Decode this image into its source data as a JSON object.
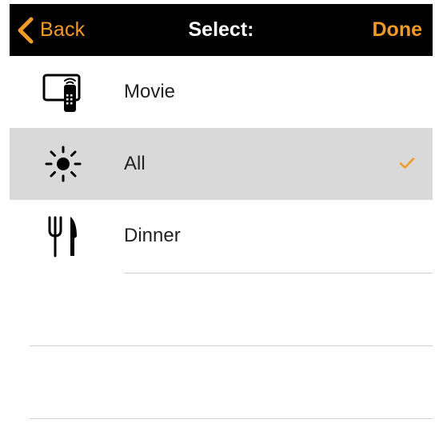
{
  "navbar": {
    "back_label": "Back",
    "title": "Select:",
    "done_label": "Done"
  },
  "options": [
    {
      "label": "Movie",
      "icon": "tv-remote-icon",
      "selected": false
    },
    {
      "label": "All",
      "icon": "sun-icon",
      "selected": true
    },
    {
      "label": "Dinner",
      "icon": "fork-knife-icon",
      "selected": false
    }
  ],
  "colors": {
    "accent": "#f29a26",
    "navbar_bg": "#000000",
    "selected_row_bg": "#d9d9d9"
  }
}
